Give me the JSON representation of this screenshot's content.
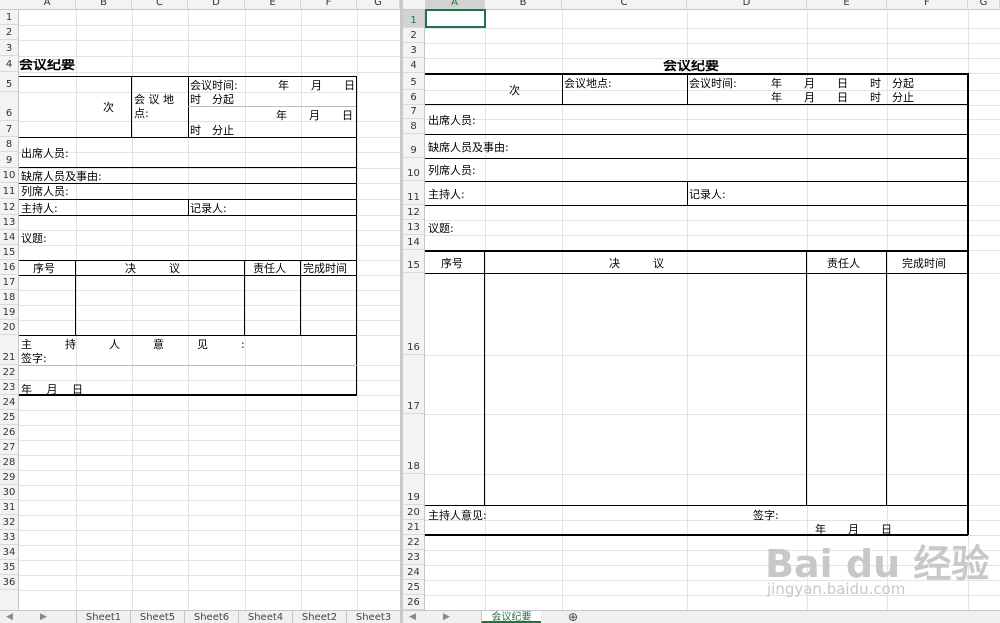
{
  "left_pane": {
    "columns": [
      "A",
      "B",
      "C",
      "D",
      "E",
      "F",
      "G"
    ],
    "rows": [
      "1",
      "2",
      "3",
      "4",
      "5",
      "6",
      "7",
      "8",
      "9",
      "10",
      "11",
      "12",
      "13",
      "14",
      "15",
      "16",
      "17",
      "18",
      "19",
      "20",
      "21",
      "22",
      "23",
      "24",
      "25",
      "26",
      "27",
      "28",
      "29",
      "30",
      "31",
      "32",
      "33",
      "34",
      "35",
      "36"
    ],
    "form": {
      "title": "会议纪要",
      "session": "次",
      "location_label": "会 议 地",
      "location_label2": "点:",
      "time_label": "会议时间:",
      "date_ymd_1": "年　　月　　日",
      "time_start": "时　分起",
      "date_ymd_2": "年　　月　　日",
      "time_end": "时　分止",
      "attendees": "出席人员:",
      "absentees": "缺席人员及事由:",
      "observers": "列席人员:",
      "host": "主持人:",
      "recorder": "记录人:",
      "agenda": "议题:",
      "col_no": "序号",
      "col_decision": "决　　　议",
      "col_owner": "责任人",
      "col_deadline": "完成时间",
      "opinion": "主　　　持　　　人　　　意　　　见　　　:",
      "signature": "签字:",
      "sign_date": "年　 月　 日"
    },
    "sheet_tabs": [
      "Sheet1",
      "Sheet5",
      "Sheet6",
      "Sheet4",
      "Sheet2",
      "Sheet3"
    ]
  },
  "right_pane": {
    "columns": [
      "A",
      "B",
      "C",
      "D",
      "E",
      "F",
      "G"
    ],
    "selected_column": "A",
    "selected_row": "1",
    "rows": [
      "1",
      "2",
      "3",
      "4",
      "5",
      "6",
      "7",
      "8",
      "9",
      "10",
      "11",
      "12",
      "13",
      "14",
      "15",
      "16",
      "17",
      "18",
      "19",
      "20",
      "21",
      "22",
      "23",
      "24",
      "25",
      "26",
      "27"
    ],
    "form": {
      "title": "会议纪要",
      "session": "次",
      "location": "会议地点:",
      "time_label": "会议时间:",
      "start_line": "年　　月　　日　　时　分起",
      "end_line": "年　　月　　日　　时　分止",
      "attendees": "出席人员:",
      "absentees": "缺席人员及事由:",
      "observers": "列席人员:",
      "host": "主持人:",
      "recorder": "记录人:",
      "agenda": "议题:",
      "col_no": "序号",
      "col_decision": "决　　　议",
      "col_owner": "责任人",
      "col_deadline": "完成时间",
      "opinion": "主持人意见:",
      "signature": "签字:",
      "sign_date": "年　　月　　日"
    },
    "sheet_tabs": [
      "会议纪要"
    ],
    "add_sheet": "⊕"
  },
  "watermark": {
    "brand": "Bai du 经验",
    "url": "jingyan.baidu.com"
  }
}
